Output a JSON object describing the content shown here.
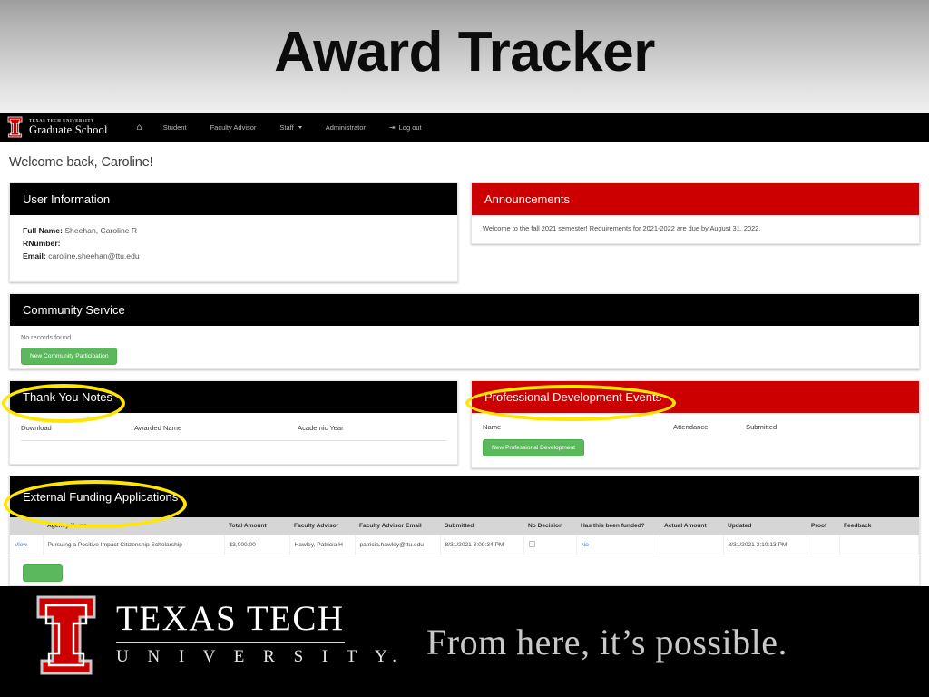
{
  "slide": {
    "title": "Award Tracker"
  },
  "navbar": {
    "brand_top": "TEXAS TECH UNIVERSITY",
    "brand_main": "Graduate School",
    "home_icon": "home-icon",
    "items": [
      {
        "label": "Student",
        "has_caret": false
      },
      {
        "label": "Faculty Advisor",
        "has_caret": false
      },
      {
        "label": "Staff",
        "has_caret": true
      },
      {
        "label": "Administrator",
        "has_caret": false
      }
    ],
    "logout_label": "Log out",
    "logout_icon": "logout-icon"
  },
  "page": {
    "welcome": "Welcome back, Caroline!"
  },
  "user_information": {
    "title": "User Information",
    "full_name_label": "Full Name:",
    "full_name_value": "Sheehan, Caroline R",
    "rnumber_label": "RNumber:",
    "rnumber_value": "",
    "email_label": "Email:",
    "email_value": "caroline.sheehan@ttu.edu"
  },
  "announcements": {
    "title": "Announcements",
    "text": "Welcome to the fall 2021 semester! Requirements for 2021-2022 are due by August 31, 2022."
  },
  "community_service": {
    "title": "Community Service",
    "empty_text": "No records found",
    "button_label": "New Community Participation"
  },
  "thank_you_notes": {
    "title": "Thank You Notes",
    "columns": [
      "Download",
      "Awarded Name",
      "Academic Year"
    ],
    "rows": []
  },
  "professional_development": {
    "title": "Professional Development Events",
    "columns": [
      "Name",
      "Attendance",
      "Submitted"
    ],
    "rows": [],
    "button_label": "New Professional Development"
  },
  "external_funding": {
    "title": "External Funding Applications",
    "columns": [
      "",
      "Agency Name",
      "Total Amount",
      "Faculty Advisor",
      "Faculty Advisor Email",
      "Submitted",
      "No Decision",
      "Has this been funded?",
      "Actual Amount",
      "Updated",
      "Proof",
      "Feedback"
    ],
    "rows": [
      {
        "view": "View",
        "agency_name": "Pursuing a Positive Impact Citizenship Scholarship",
        "total_amount": "$3,000.00",
        "faculty_advisor": "Hawley, Patricia H",
        "faculty_advisor_email": "patricia.hawley@ttu.edu",
        "submitted": "8/31/2021 3:09:34 PM",
        "no_decision": "",
        "has_been_funded": "No",
        "actual_amount": "",
        "updated": "8/31/2021 3:10:13 PM",
        "proof": "",
        "feedback": ""
      }
    ]
  },
  "footer": {
    "university_line1": "TEXAS TECH",
    "university_line2": "U N I V E R S I T Y.",
    "tagline": "From here, it’s possible."
  },
  "highlights": {
    "color": "#ffe600",
    "targets": [
      "Thank You Notes",
      "Professional Development Events",
      "External Funding Applications"
    ]
  }
}
